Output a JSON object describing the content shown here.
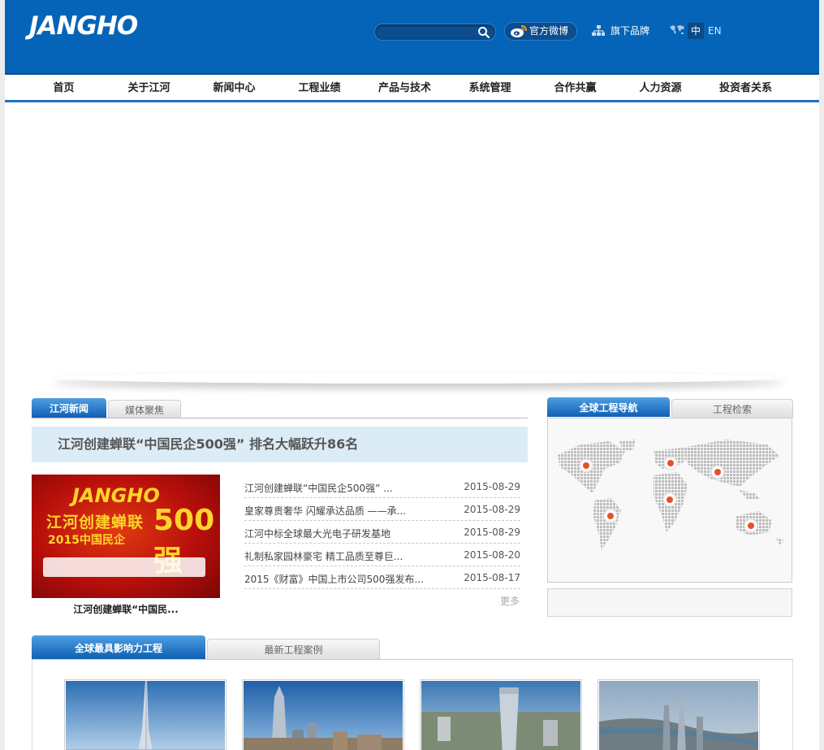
{
  "header": {
    "logo": "JANGHO",
    "search": {
      "placeholder": "",
      "value": ""
    },
    "weibo_label": "官方微博",
    "brands_label": "旗下品牌",
    "lang_zh": "中",
    "lang_en": "EN"
  },
  "nav": {
    "items": [
      "首页",
      "关于江河",
      "新闻中心",
      "工程业绩",
      "产品与技术",
      "系统管理",
      "合作共赢",
      "人力资源",
      "投资者关系"
    ]
  },
  "news": {
    "tabs": [
      "江河新闻",
      "媒体聚焦"
    ],
    "headline": "江河创建蝉联“中国民企500强” 排名大幅跃升86名",
    "image": {
      "brand": "JANGHO",
      "title": "江河创建蝉联",
      "number": "500强",
      "subtitle": "2015中国民企"
    },
    "caption": "江河创建蝉联“中国民...",
    "items": [
      {
        "title": "江河创建蝉联“中国民企500强” ...",
        "date": "2015-08-29"
      },
      {
        "title": "皇家尊贵奢华 闪耀承达品质 ——承...",
        "date": "2015-08-29"
      },
      {
        "title": "江河中标全球最大光电子研发基地",
        "date": "2015-08-29"
      },
      {
        "title": "礼制私家园林豪宅 精工品质至尊巨...",
        "date": "2015-08-20"
      },
      {
        "title": "2015《财富》中国上市公司500强发布...",
        "date": "2015-08-17"
      }
    ],
    "more": "更多"
  },
  "projects_panel": {
    "tabs": [
      "全球工程导航",
      "工程检索"
    ]
  },
  "projects": {
    "tabs": [
      "全球最具影响力工程",
      "最新工程案例"
    ]
  },
  "colors": {
    "header_bg": "#0564b8",
    "nav_underline": "#1f72c1",
    "tab_active": "#0e5fb3",
    "map_marker": "#e8502a"
  }
}
